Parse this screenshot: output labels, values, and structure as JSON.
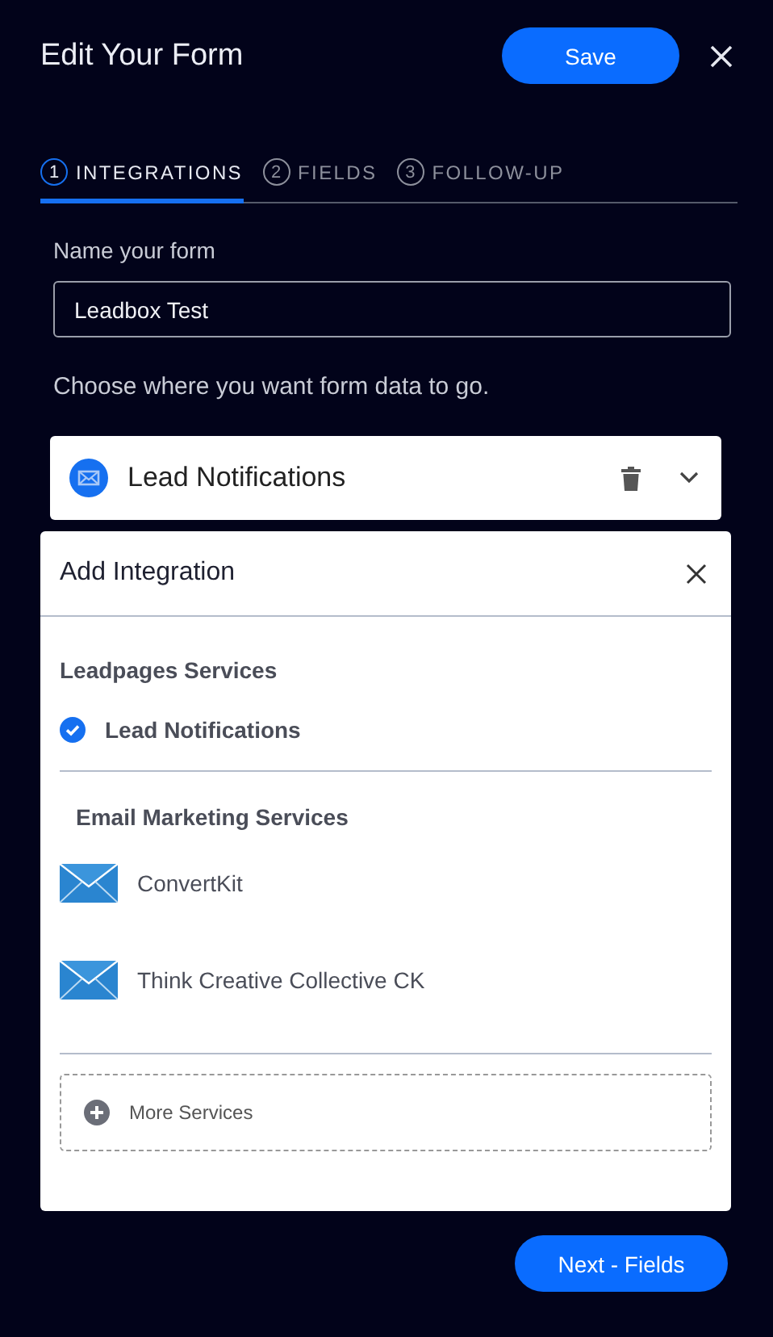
{
  "header": {
    "title": "Edit Your Form",
    "save_button": "Save"
  },
  "tabs": [
    {
      "number": "1",
      "label": "INTEGRATIONS",
      "selected": true
    },
    {
      "number": "2",
      "label": "FIELDS",
      "selected": false
    },
    {
      "number": "3",
      "label": "FOLLOW-UP",
      "selected": false
    }
  ],
  "form_name": {
    "label": "Name your form",
    "value": "Leadbox Test"
  },
  "instructions": "Choose where you want form data to go.",
  "integration_card": {
    "title": "Lead Notifications",
    "expanded": false
  },
  "add_integration": {
    "title": "Add Integration",
    "sections": [
      {
        "heading": "Leadpages Services",
        "items": [
          {
            "kind": "check",
            "label": "Lead Notifications",
            "checked": true
          }
        ]
      },
      {
        "heading": "Email Marketing Services",
        "items": [
          {
            "kind": "mail",
            "label": "ConvertKit"
          },
          {
            "kind": "mail",
            "label": "Think Creative Collective CK"
          }
        ]
      }
    ],
    "more_button": "More Services"
  },
  "next_button": "Next - Fields"
}
